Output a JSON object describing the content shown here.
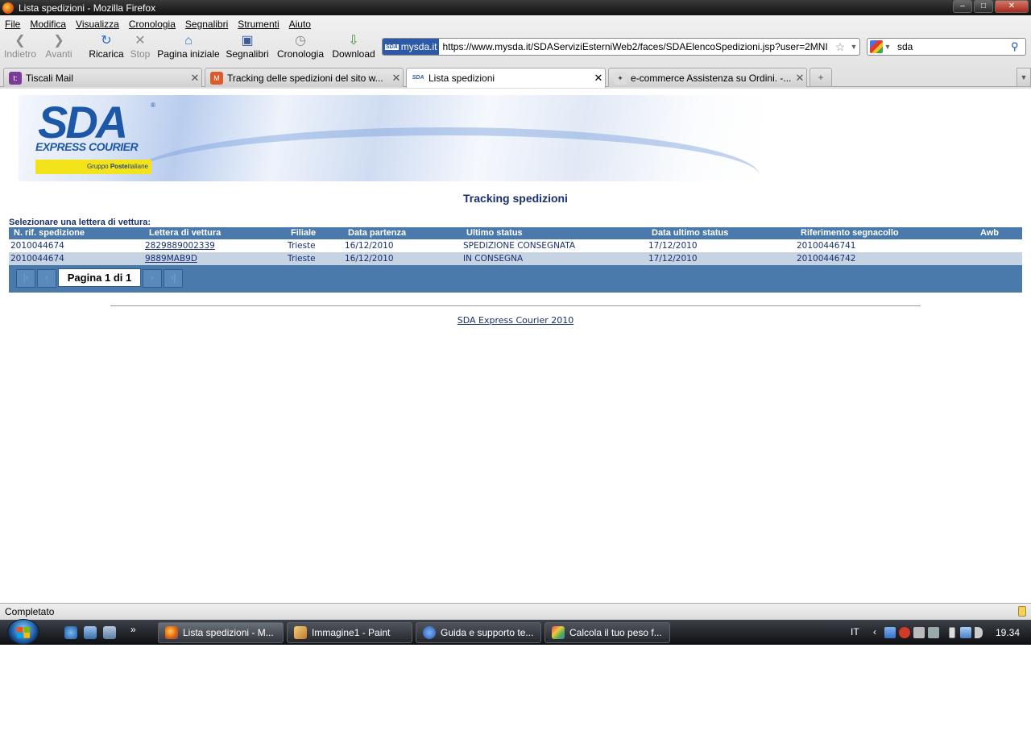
{
  "window": {
    "title": "Lista spedizioni - Mozilla Firefox"
  },
  "menu": [
    "File",
    "Modifica",
    "Visualizza",
    "Cronologia",
    "Segnalibri",
    "Strumenti",
    "Aiuto"
  ],
  "nav": {
    "back": "Indietro",
    "forward": "Avanti",
    "reload": "Ricarica",
    "stop": "Stop",
    "home": "Pagina iniziale",
    "bookmarks": "Segnalibri",
    "history": "Cronologia",
    "downloads": "Download"
  },
  "urlbar": {
    "site_identity": "mysda.it",
    "url": "https://www.mysda.it/SDAServiziEsterniWeb2/faces/SDAElencoSpedizioni.jsp?user=2MNI"
  },
  "search": {
    "value": "sda"
  },
  "tabs": [
    {
      "label": "Tiscali Mail",
      "active": false
    },
    {
      "label": "Tracking delle spedizioni del sito w...",
      "active": false
    },
    {
      "label": "Lista spedizioni",
      "active": true
    },
    {
      "label": "e-commerce Assistenza su Ordini. -...",
      "active": false
    }
  ],
  "logo": {
    "brand": "SDA",
    "tagline": "EXPRESS COURIER",
    "group_prefix": "Gruppo ",
    "group_bold": "Poste",
    "group_suffix": "italiane"
  },
  "page": {
    "title": "Tracking spedizioni",
    "select_label": "Selezionare una lettera di vettura:"
  },
  "table": {
    "headers": {
      "rif": "N. rif. spedizione",
      "lettera": "Lettera di vettura",
      "filiale": "Filiale",
      "partenza": "Data partenza",
      "status": "Ultimo status",
      "data_status": "Data ultimo status",
      "segnacollo": "Riferimento segnacollo",
      "awb": "Awb"
    },
    "rows": [
      {
        "rif": "2010044674",
        "lettera": "2829889002339",
        "filiale": "Trieste",
        "partenza": "16/12/2010",
        "status": "SPEDIZIONE CONSEGNATA",
        "data_status": "17/12/2010",
        "segnacollo": "20100446741",
        "awb": ""
      },
      {
        "rif": "2010044674",
        "lettera": "9889MAB9D",
        "filiale": "Trieste",
        "partenza": "16/12/2010",
        "status": "IN CONSEGNA",
        "data_status": "17/12/2010",
        "segnacollo": "20100446742",
        "awb": ""
      }
    ],
    "pager": {
      "info": "Pagina 1 di 1",
      "first": "|‹",
      "prev": "‹",
      "next": "›",
      "last": "›|"
    }
  },
  "footer": {
    "link": "SDA Express Courier 2010"
  },
  "status": {
    "text": "Completato"
  },
  "taskbar": {
    "items": [
      {
        "label": "Lista spedizioni - M...",
        "icon": "firefox-icon",
        "color": "#e56b1f"
      },
      {
        "label": "Immagine1 - Paint",
        "icon": "paint-icon",
        "color": "#d9a441"
      },
      {
        "label": "Guida e supporto te...",
        "icon": "help-icon",
        "color": "#3d7bd9"
      },
      {
        "label": "Calcola il tuo peso f...",
        "icon": "colorful-app-icon",
        "color": "#c04a8e"
      }
    ],
    "language": "IT",
    "clock": "19.34"
  },
  "colors": {
    "grid_header": "#4a79ab",
    "grid_alt_row": "#c5d3e2",
    "brand_blue": "#1d57a8",
    "poste_yellow": "#f3e31b"
  }
}
